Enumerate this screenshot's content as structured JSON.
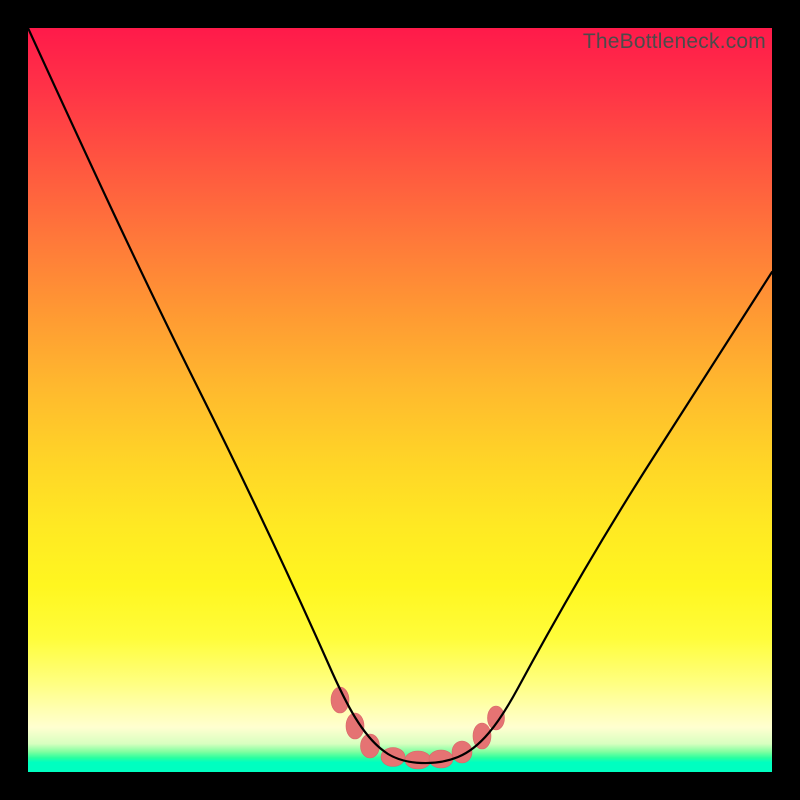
{
  "watermark": "TheBottleneck.com",
  "colors": {
    "frame": "#000000",
    "watermark": "#4b4b4b",
    "curve": "#000000",
    "markers": "#e57373",
    "gradient_top": "#ff1a4a",
    "gradient_mid": "#ffe923",
    "gradient_bottom": "#00ffc0"
  },
  "chart_data": {
    "type": "line",
    "title": "",
    "xlabel": "",
    "ylabel": "",
    "xlim": [
      0,
      100
    ],
    "ylim": [
      0,
      100
    ],
    "grid": false,
    "legend": false,
    "note": "Axes are unlabeled; values below are read off the plot area as percentages of width (x) and height from bottom (y). The curve is a V/well shape with a flat minimum near y≈1–2 centered around x≈48–58, left arm reaching top-left corner, right arm exiting near x=100 at y≈72.",
    "x": [
      0,
      4,
      8,
      12,
      16,
      20,
      24,
      28,
      32,
      36,
      38,
      40,
      42,
      44,
      46,
      48,
      50,
      52,
      54,
      56,
      58,
      60,
      62,
      64,
      68,
      72,
      76,
      80,
      84,
      88,
      92,
      96,
      100
    ],
    "y": [
      100,
      92,
      83,
      74,
      66,
      57,
      49,
      40,
      32,
      23,
      19,
      15,
      11,
      7,
      4,
      2,
      1.5,
      1.3,
      1.3,
      1.5,
      2,
      3.5,
      6,
      9,
      16,
      24,
      31,
      39,
      46,
      53,
      60,
      66,
      72
    ],
    "markers": {
      "note": "Pink rounded blobs near the well bottom, approx x,y in % coords",
      "points": [
        {
          "x": 42.0,
          "y": 9.5
        },
        {
          "x": 44.0,
          "y": 6.0
        },
        {
          "x": 46.0,
          "y": 3.3
        },
        {
          "x": 49.0,
          "y": 1.8
        },
        {
          "x": 52.0,
          "y": 1.5
        },
        {
          "x": 55.0,
          "y": 1.7
        },
        {
          "x": 58.0,
          "y": 2.5
        },
        {
          "x": 61.0,
          "y": 4.5
        },
        {
          "x": 63.0,
          "y": 7.0
        }
      ]
    }
  }
}
